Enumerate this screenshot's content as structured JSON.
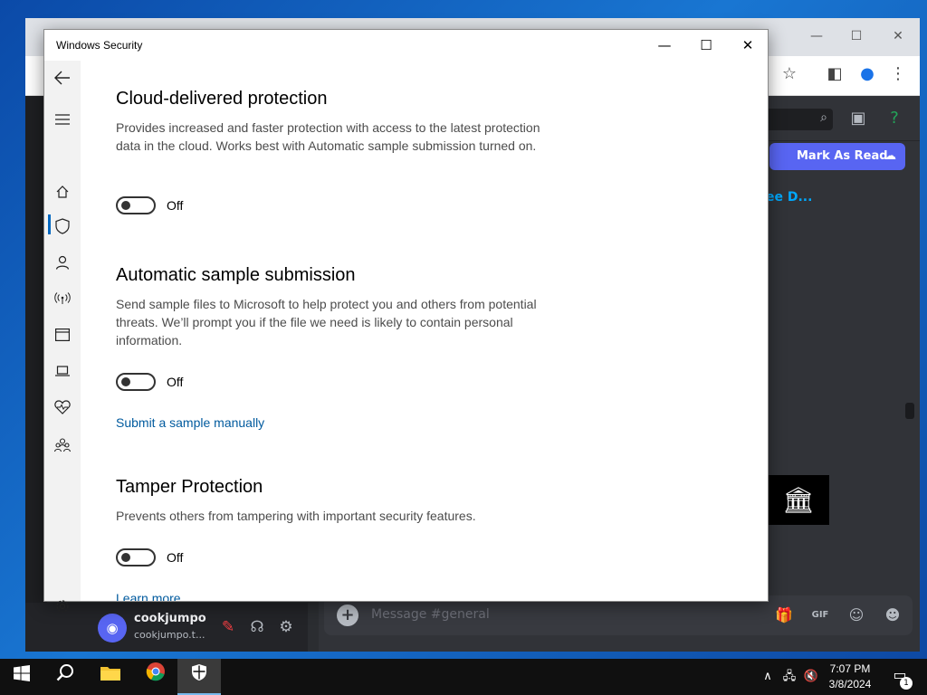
{
  "window": {
    "title": "Windows Security",
    "minimize_glyph": "—",
    "maximize_glyph": "☐",
    "close_glyph": "✕"
  },
  "nav": {
    "back_icon": "back-arrow-icon",
    "items": [
      {
        "icon": "hamburger-menu-icon"
      },
      {
        "icon": "home-icon"
      },
      {
        "icon": "shield-icon",
        "active": true
      },
      {
        "icon": "person-icon"
      },
      {
        "icon": "wireless-network-icon"
      },
      {
        "icon": "app-browser-icon"
      },
      {
        "icon": "laptop-icon"
      },
      {
        "icon": "heart-pulse-icon"
      },
      {
        "icon": "family-icon"
      }
    ],
    "settings_icon": "gear-icon"
  },
  "sections": [
    {
      "heading": "Cloud-delivered protection",
      "description": "Provides increased and faster protection with access to the latest protection data in the cloud. Works best with Automatic sample submission turned on.",
      "toggle_state": "Off"
    },
    {
      "heading": "Automatic sample submission",
      "description": "Send sample files to Microsoft to help protect you and others from potential threats. We’ll prompt you if the file we need is likely to contain personal information.",
      "toggle_state": "Off",
      "link": "Submit a sample manually"
    },
    {
      "heading": "Tamper Protection",
      "description": "Prevents others from tampering with important security features.",
      "toggle_state": "Off",
      "link": "Learn more"
    }
  ],
  "background_app": {
    "mark_as_read": "Mark As Read",
    "see_link_partial": "ee D...",
    "username": "cookjumpo",
    "user_status": "cookjumpo.t...",
    "message_placeholder": "Message #general",
    "gif_label": "GIF"
  },
  "taskbar": {
    "time": "7:07 PM",
    "date": "3/8/2024",
    "notification_count": "1",
    "apps": [
      "start-icon",
      "search-icon",
      "file-explorer-icon",
      "chrome-icon",
      "windows-security-icon"
    ]
  },
  "colors": {
    "accent": "#0067c0",
    "link": "#005a9e",
    "discord_blurple": "#5865f2",
    "taskbar": "#101010"
  }
}
